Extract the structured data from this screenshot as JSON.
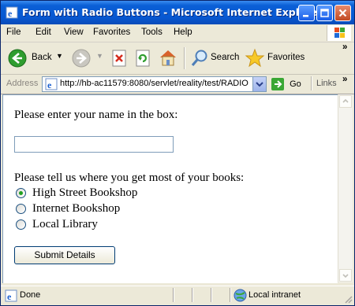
{
  "window": {
    "title": "Form with Radio Buttons - Microsoft Internet Explorer"
  },
  "menu": [
    "File",
    "Edit",
    "View",
    "Favorites",
    "Tools",
    "Help"
  ],
  "toolbar": {
    "back_label": "Back",
    "search_label": "Search",
    "favorites_label": "Favorites"
  },
  "address": {
    "label": "Address",
    "url": "http://hb-ac11579:8080/servlet/reality/test/RADIO",
    "go_label": "Go",
    "links_label": "Links"
  },
  "form": {
    "name_prompt": "Please enter your name in the box:",
    "name_value": "",
    "source_prompt": "Please tell us where you get most of your books:",
    "options": [
      {
        "label": "High Street Bookshop",
        "selected": true
      },
      {
        "label": "Internet Bookshop",
        "selected": false
      },
      {
        "label": "Local Library",
        "selected": false
      }
    ],
    "submit_label": "Submit Details"
  },
  "status": {
    "text": "Done",
    "zone": "Local intranet"
  },
  "colors": {
    "titlebar": "#0758d2",
    "chrome": "#ece9d8",
    "radio_selected": "#21a121"
  }
}
